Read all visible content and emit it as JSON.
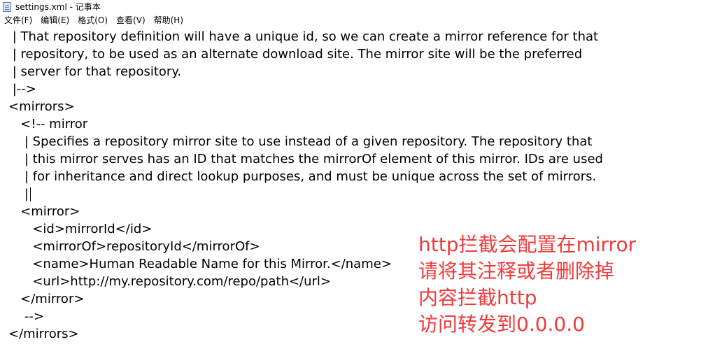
{
  "window": {
    "title": "settings.xml - 记事本"
  },
  "menu": [
    {
      "label": "文件(F)"
    },
    {
      "label": "编辑(E)"
    },
    {
      "label": "格式(O)"
    },
    {
      "label": "查看(V)"
    },
    {
      "label": "帮助(H)"
    }
  ],
  "editor": {
    "lines": [
      " | That repository definition will have a unique id, so we can create a mirror reference for that",
      " | repository, to be used as an alternate download site. The mirror site will be the preferred",
      " | server for that repository.",
      " |-->",
      "<mirrors>",
      "   <!-- mirror",
      "    | Specifies a repository mirror site to use instead of a given repository. The repository that",
      "    | this mirror serves has an ID that matches the mirrorOf element of this mirror. IDs are used",
      "    | for inheritance and direct lookup purposes, and must be unique across the set of mirrors.",
      "    |",
      "   <mirror>",
      "      <id>mirrorId</id>",
      "      <mirrorOf>repositoryId</mirrorOf>",
      "      <name>Human Readable Name for this Mirror.</name>",
      "      <url>http://my.repository.com/repo/path</url>",
      "   </mirror>",
      "    -->",
      "</mirrors>"
    ]
  },
  "annotation": {
    "lines": [
      "http拦截会配置在mirror",
      "请将其注释或者删除掉",
      "内容拦截http",
      "访问转发到0.0.0.0"
    ],
    "color": "#f23a3a"
  }
}
